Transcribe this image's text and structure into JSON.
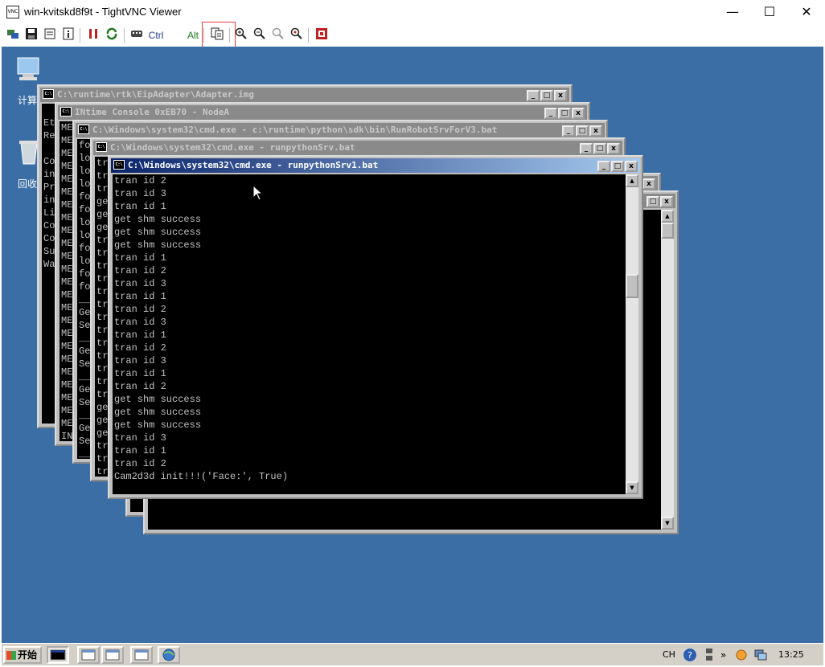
{
  "window": {
    "title": "win-kvitskd8f9t - TightVNC Viewer",
    "app_icon_label": "VNC",
    "minimize_glyph": "—",
    "maximize_glyph": "☐",
    "close_glyph": "✕"
  },
  "toolbar": {
    "ctrl_label": "Ctrl",
    "alt_label": "Alt",
    "icons": [
      "new-connection-icon",
      "save-icon",
      "options-icon",
      "info-icon",
      "pause-icon",
      "refresh-icon",
      "ctrl-alt-del-icon",
      "clipboard-icon",
      "zoom-in-icon",
      "zoom-out-icon",
      "zoom-100-icon",
      "zoom-auto-icon",
      "fullscreen-icon"
    ]
  },
  "desktop": {
    "icons": [
      {
        "name": "computer-icon",
        "label": "计算"
      },
      {
        "name": "recycle-bin-icon",
        "label": "回收"
      }
    ]
  },
  "consoles": [
    {
      "title": "C:\\runtime\\rtk\\EipAdapter\\Adapter.img",
      "lines": [
        "",
        "Et",
        "Re",
        "",
        "Co",
        "in",
        "Pr",
        "in",
        "Li",
        "Co",
        "Co",
        "Su",
        "Wa"
      ]
    },
    {
      "title": "INtime Console 0xEB70 - NodeA",
      "lines": [
        "ME",
        "ME",
        "ME",
        "ME",
        "ME",
        "ME",
        "ME",
        "ME",
        "ME",
        "ME",
        "ME",
        "ME",
        "ME",
        "ME",
        "ME",
        "ME",
        "ME",
        "ME",
        "ME",
        "ME",
        "ME",
        "ME",
        "ME",
        "ME",
        "IN",
        "IN"
      ]
    },
    {
      "title": "C:\\Windows\\system32\\cmd.exe - c:\\runtime\\python\\sdk\\bin\\RunRobotSrvForV3.bat",
      "lines": [
        "fo",
        "lo",
        "lo",
        "lo",
        "fo",
        "fo",
        "lo",
        "lo",
        "fo",
        "lo",
        "fo",
        "fo",
        "__",
        "Ge",
        "Se",
        "__",
        "Ge",
        "Se",
        "__",
        "Ge",
        "Se",
        "__",
        "Ge",
        "Se",
        "__"
      ]
    },
    {
      "title": "C:\\Windows\\system32\\cmd.exe - runpythonSrv.bat",
      "lines": [
        "tr",
        "tr",
        "tr",
        "ge",
        "ge",
        "ge",
        "tr",
        "tr",
        "tr",
        "tr",
        "tr",
        "tr",
        "tr",
        "tr",
        "tr",
        "tr",
        "tr",
        "tr",
        "tr",
        "ge",
        "ge",
        "ge",
        "tr",
        "tr",
        "tr",
        "Ca"
      ]
    }
  ],
  "active_console": {
    "title": "C:\\Windows\\system32\\cmd.exe - runpythonSrv1.bat",
    "lines": [
      "tran id 2",
      "tran id 3",
      "tran id 1",
      "get shm success",
      "get shm success",
      "get shm success",
      "tran id 1",
      "tran id 2",
      "tran id 3",
      "tran id 1",
      "tran id 2",
      "tran id 3",
      "tran id 1",
      "tran id 2",
      "tran id 3",
      "tran id 1",
      "tran id 2",
      "get shm success",
      "get shm success",
      "get shm success",
      "tran id 3",
      "tran id 1",
      "tran id 2",
      "Cam2d3d init!!!('Face:', True)"
    ]
  },
  "taskbar": {
    "start_label": "开始",
    "lang": "CH",
    "clock": "13:25"
  }
}
